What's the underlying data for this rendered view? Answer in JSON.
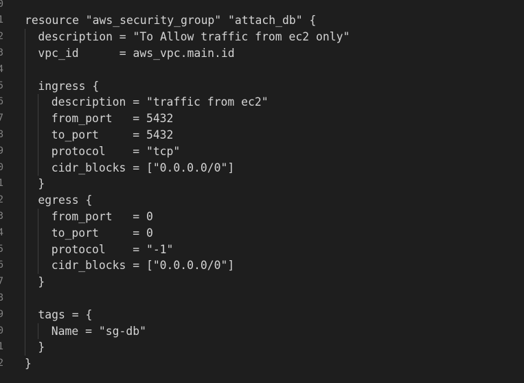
{
  "editor": {
    "line_numbers": [
      "0",
      "1",
      "2",
      "3",
      "4",
      "5",
      "6",
      "7",
      "8",
      "9",
      "0",
      "1",
      "2",
      "3",
      "4",
      "5",
      "6",
      "7",
      "8",
      "9",
      "0",
      "1",
      "2"
    ],
    "lines": [
      {
        "indent": 0,
        "text": "resource \"aws_security_group\" \"attach_db\" {"
      },
      {
        "indent": 1,
        "text": "description = \"To Allow traffic from ec2 only\""
      },
      {
        "indent": 1,
        "text": "vpc_id      = aws_vpc.main.id"
      },
      {
        "indent": 0,
        "text": ""
      },
      {
        "indent": 1,
        "text": "ingress {"
      },
      {
        "indent": 2,
        "text": "description = \"traffic from ec2\""
      },
      {
        "indent": 2,
        "text": "from_port   = 5432"
      },
      {
        "indent": 2,
        "text": "to_port     = 5432"
      },
      {
        "indent": 2,
        "text": "protocol    = \"tcp\""
      },
      {
        "indent": 2,
        "text": "cidr_blocks = [\"0.0.0.0/0\"]"
      },
      {
        "indent": 1,
        "text": "}"
      },
      {
        "indent": 1,
        "text": "egress {"
      },
      {
        "indent": 2,
        "text": "from_port   = 0"
      },
      {
        "indent": 2,
        "text": "to_port     = 0"
      },
      {
        "indent": 2,
        "text": "protocol    = \"-1\""
      },
      {
        "indent": 2,
        "text": "cidr_blocks = [\"0.0.0.0/0\"]"
      },
      {
        "indent": 1,
        "text": "}"
      },
      {
        "indent": 0,
        "text": ""
      },
      {
        "indent": 1,
        "text": "tags = {"
      },
      {
        "indent": 2,
        "text": "Name = \"sg-db\""
      },
      {
        "indent": 1,
        "text": "}"
      },
      {
        "indent": 0,
        "text": "}"
      }
    ]
  }
}
